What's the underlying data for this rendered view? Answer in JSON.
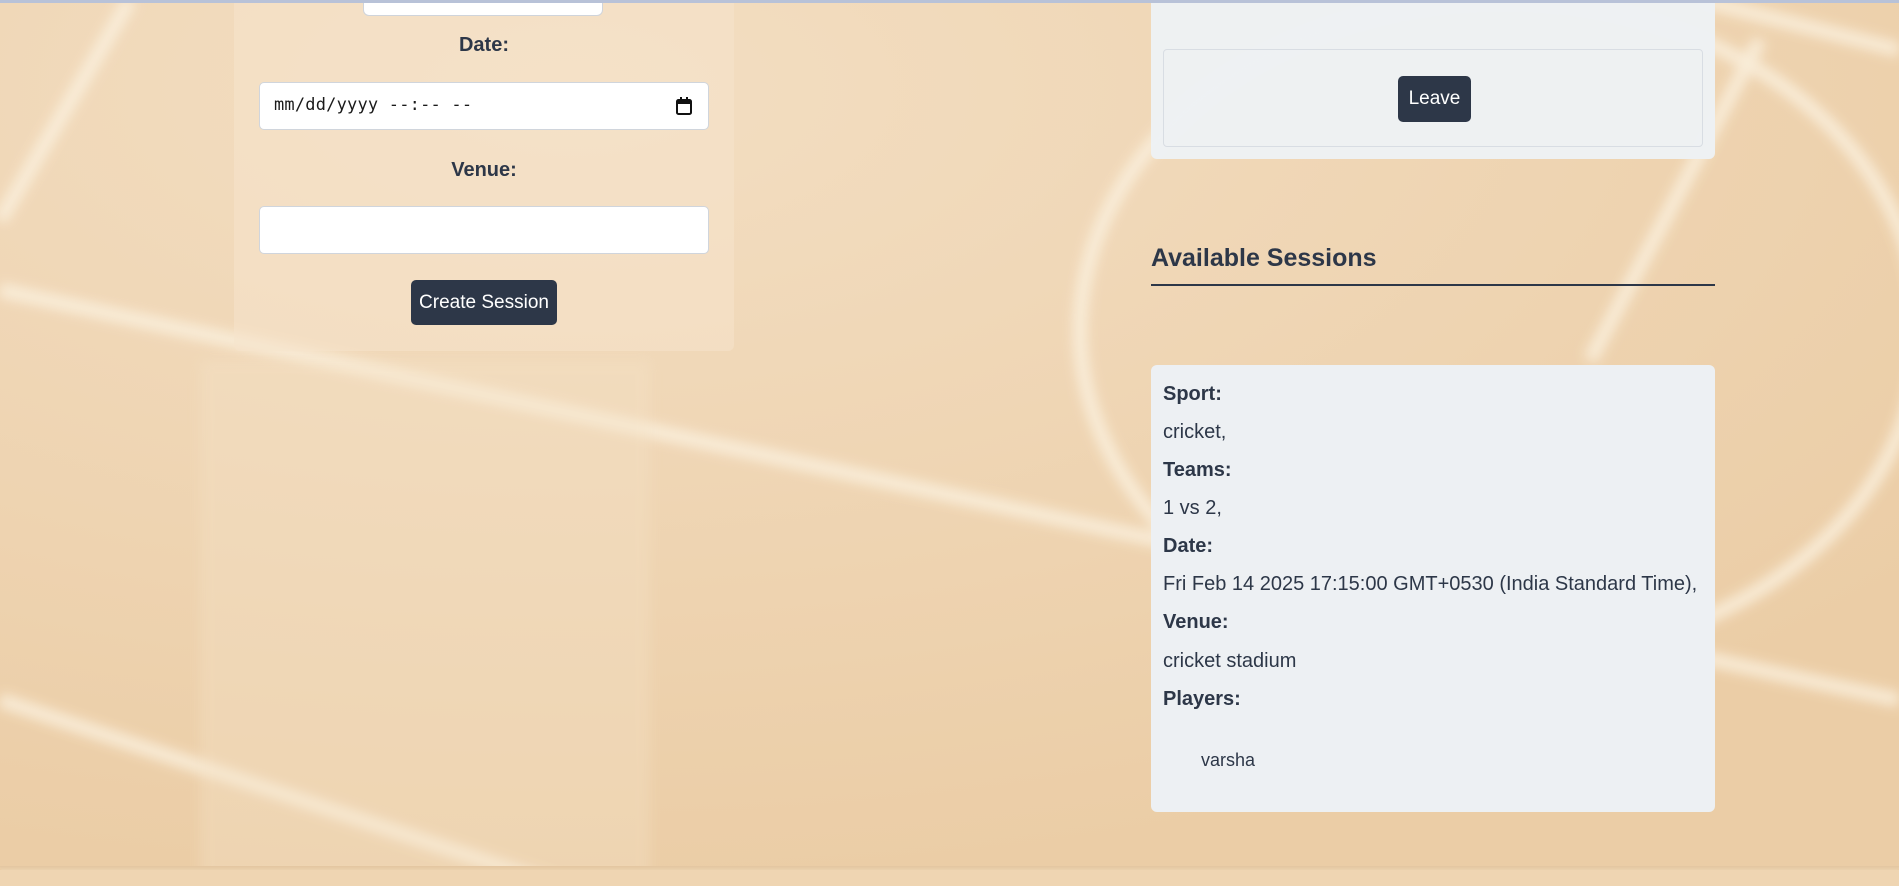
{
  "create_form": {
    "date_label": "Date:",
    "date_placeholder": "mm/dd/yyyy --:-- --",
    "venue_label": "Venue:",
    "venue_value": "",
    "create_button": "Create Session"
  },
  "joined_session": {
    "leave_button": "Leave"
  },
  "available_sessions": {
    "title": "Available Sessions",
    "sessions": [
      {
        "sport_label": "Sport:",
        "sport_value": "cricket,",
        "teams_label": "Teams:",
        "teams_value": "1 vs 2,",
        "date_label": "Date:",
        "date_value": "Fri Feb 14 2025 17:15:00 GMT+0530 (India Standard Time),",
        "venue_label": "Venue:",
        "venue_value": "cricket stadium",
        "players_label": "Players:",
        "players": [
          "varsha"
        ]
      }
    ]
  },
  "colors": {
    "primary_button": "#2d3748",
    "card_background": "#edf0f3",
    "page_background": "#ecd5b3"
  },
  "icons": {
    "date_picker": "calendar-icon"
  }
}
